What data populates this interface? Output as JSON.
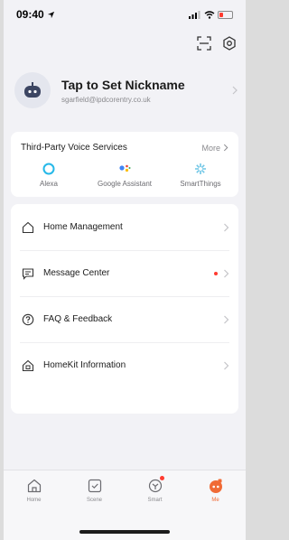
{
  "status_bar": {
    "time": "09:40"
  },
  "profile": {
    "nickname": "Tap to Set Nickname",
    "email": "sgarfield@ipdcorentry.co.uk"
  },
  "voice_services": {
    "title": "Third-Party Voice Services",
    "more_label": "More",
    "items": [
      {
        "label": "Alexa",
        "icon": "alexa-icon"
      },
      {
        "label": "Google Assistant",
        "icon": "google-assistant-icon"
      },
      {
        "label": "SmartThings",
        "icon": "smartthings-icon"
      }
    ]
  },
  "menu": [
    {
      "label": "Home Management",
      "icon": "home-icon",
      "has_dot": false
    },
    {
      "label": "Message Center",
      "icon": "message-icon",
      "has_dot": true
    },
    {
      "label": "FAQ & Feedback",
      "icon": "help-icon",
      "has_dot": false
    },
    {
      "label": "HomeKit Information",
      "icon": "homekit-icon",
      "has_dot": false
    }
  ],
  "tabs": [
    {
      "label": "Home",
      "icon": "home-tab-icon",
      "active": false
    },
    {
      "label": "Scene",
      "icon": "scene-tab-icon",
      "active": false
    },
    {
      "label": "Smart",
      "icon": "smart-tab-icon",
      "active": false,
      "badge": true
    },
    {
      "label": "Me",
      "icon": "me-tab-icon",
      "active": true
    }
  ],
  "colors": {
    "accent": "#f06a35",
    "badge": "#ff3b30",
    "background": "#f2f2f6",
    "alexa": "#26b8e8",
    "smartthings": "#6fc6e6"
  }
}
